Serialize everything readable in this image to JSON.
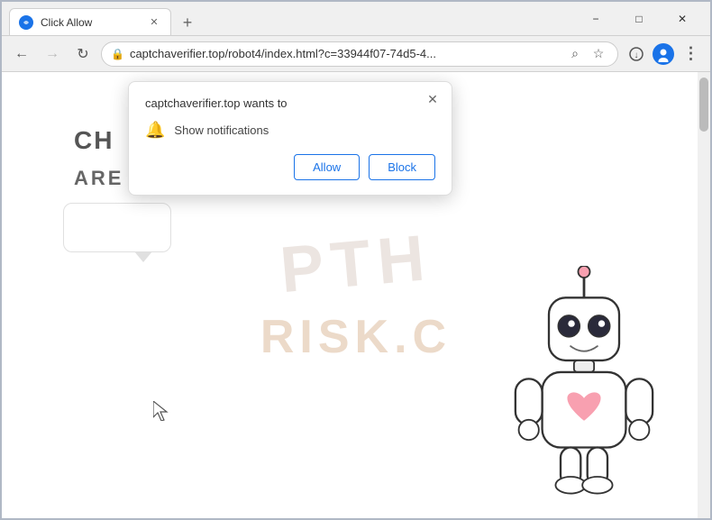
{
  "browser": {
    "tab_title": "Click Allow",
    "tab_favicon": "☆",
    "new_tab_icon": "+",
    "window_controls": {
      "minimize": "−",
      "maximize": "□",
      "close": "✕"
    },
    "nav": {
      "back": "←",
      "forward": "→",
      "reload": "↻",
      "address": "captchaverifier.top/robot4/index.html?c=33944f07-74d5-4...",
      "search_icon": "⌕",
      "bookmark_icon": "☆",
      "profile_icon": "👤",
      "menu_icon": "⋮",
      "download_icon": "↓"
    }
  },
  "popup": {
    "title": "captchaverifier.top wants to",
    "close_icon": "✕",
    "permission_icon": "🔔",
    "permission_text": "Show notifications",
    "allow_label": "Allow",
    "block_label": "Block"
  },
  "page": {
    "header_text": "CH",
    "subtext": "ARE NOT A ROBOT.",
    "watermark_top": "PTH",
    "watermark_bottom": "RISK.C"
  }
}
